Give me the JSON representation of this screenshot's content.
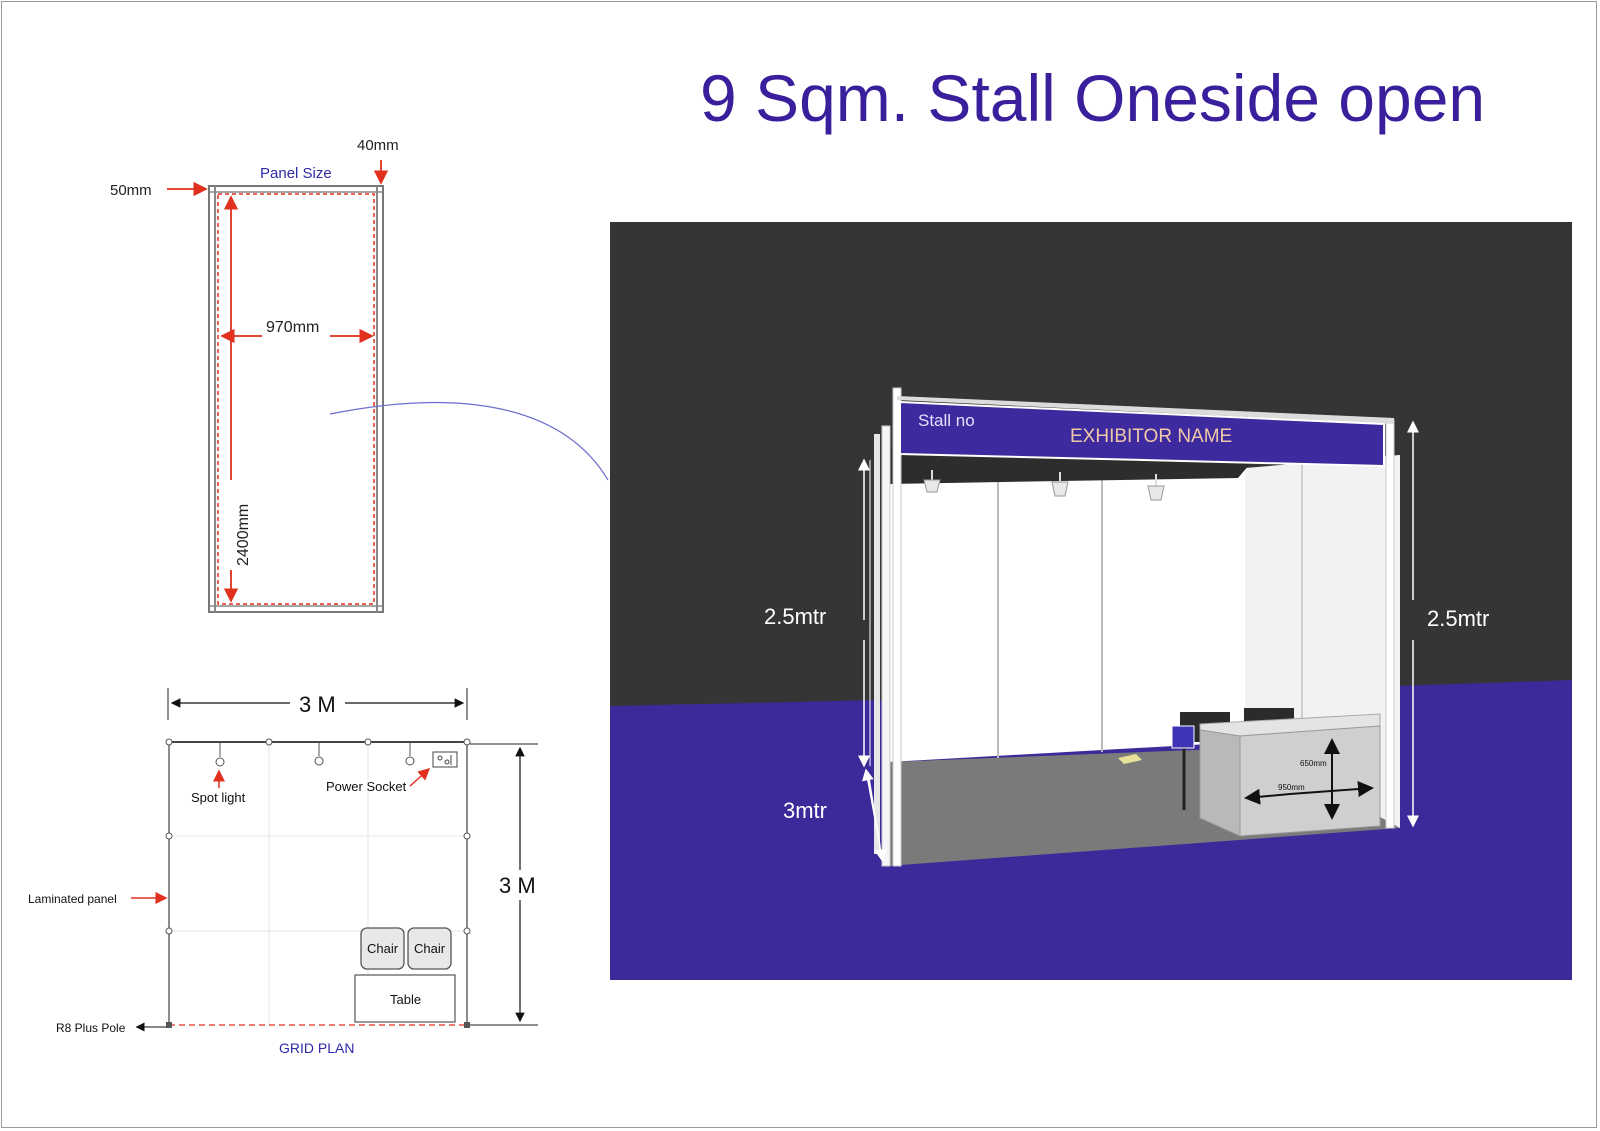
{
  "title": "9 Sqm. Stall Oneside open",
  "panel": {
    "label": "Panel Size",
    "top_dim": "40mm",
    "side_dim": "50mm",
    "width_dim": "970mm",
    "height_dim": "2400mm"
  },
  "grid_plan": {
    "caption": "GRID PLAN",
    "width_dim": "3 M",
    "depth_dim": "3 M",
    "labels": {
      "spot_light": "Spot light",
      "power_socket": "Power Socket",
      "laminated_panel": "Laminated panel",
      "pole": "R8 Plus Pole",
      "chair": "Chair",
      "table": "Table"
    }
  },
  "render": {
    "fascia_stall_no": "Stall no",
    "fascia_exhibitor": "EXHIBITOR NAME",
    "height_left": "2.5mtr",
    "height_right": "2.5mtr",
    "depth": "3mtr",
    "table_height": "650mm",
    "table_width": "950mm"
  },
  "colors": {
    "title": "#3a1f9c",
    "floor_blue": "#3a2a9a",
    "backdrop": "#353535",
    "fascia": "#3d2a9e",
    "dimension_red": "#e0301e"
  }
}
